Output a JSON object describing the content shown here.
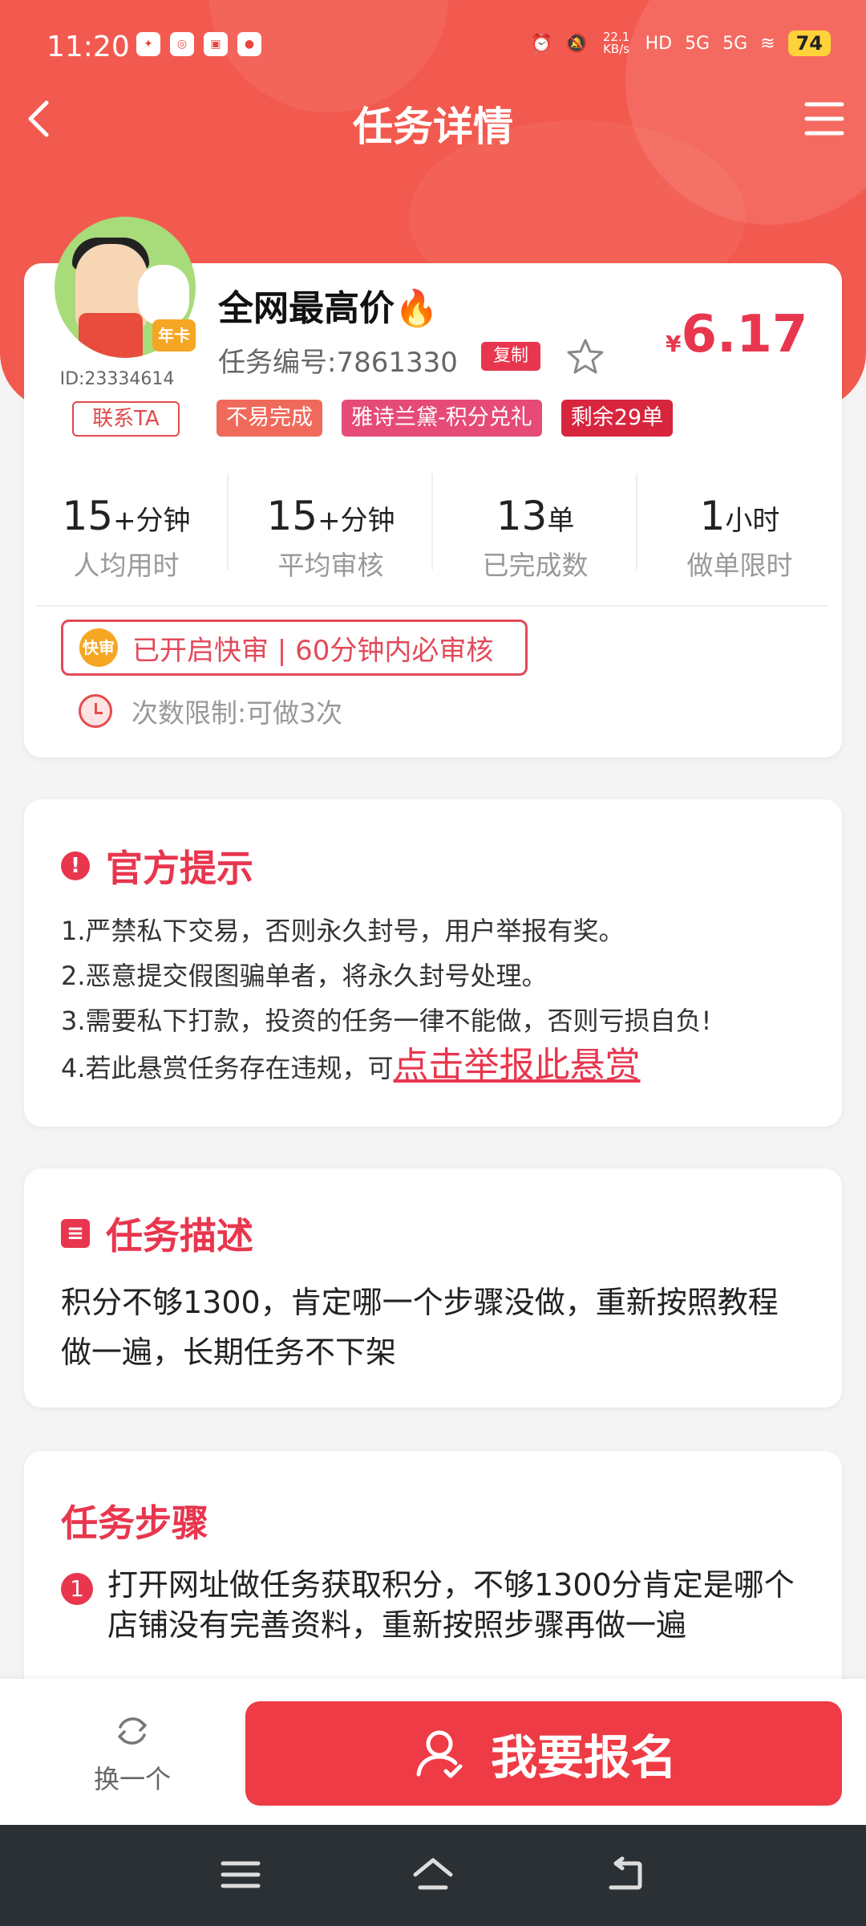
{
  "status_bar": {
    "time": "11:20",
    "net_speed": "22.1",
    "net_unit": "KB/s",
    "hd": "HD",
    "sig1": "5G",
    "sig2": "5G",
    "battery": "74"
  },
  "header": {
    "title": "任务详情"
  },
  "task": {
    "name": "全网最高价🔥",
    "task_id": "任务编号:7861330",
    "copy_label": "复制",
    "price_currency": "¥",
    "price_value": "6.17",
    "user_id": "ID:23334614",
    "badge": "年卡",
    "contact_label": "联系TA",
    "tags": [
      "不易完成",
      "雅诗兰黛-积分兑礼",
      "剩余29单"
    ],
    "stats": [
      {
        "value": "15",
        "unit": "+分钟",
        "label": "人均用时"
      },
      {
        "value": "15",
        "unit": "+分钟",
        "label": "平均审核"
      },
      {
        "value": "13",
        "unit": "单",
        "label": "已完成数"
      },
      {
        "value": "1",
        "unit": "小时",
        "label": "做单限时"
      }
    ],
    "fast_icon": "快审",
    "fast_review": "已开启快审 | 60分钟内必审核",
    "limit": "次数限制:可做3次"
  },
  "notice": {
    "title": "官方提示",
    "lines": [
      "1.严禁私下交易，否则永久封号，用户举报有奖。",
      "2.恶意提交假图骗单者，将永久封号处理。",
      "3.需要私下打款，投资的任务一律不能做，否则亏损自负!",
      "4.若此悬赏任务存在违规，可"
    ],
    "report_link": "点击举报此悬赏"
  },
  "description": {
    "title": "任务描述",
    "text": "积分不够1300，肯定哪一个步骤没做，重新按照教程做一遍，长期任务不下架"
  },
  "steps": {
    "title": "任务步骤",
    "items": [
      {
        "num": "1",
        "text": "打开网址做任务获取积分，不够1300分肯定是哪个店铺没有完善资料，重新按照步骤再做一遍"
      }
    ]
  },
  "bottom_bar": {
    "switch_label": "换一个",
    "signup_label": "我要报名"
  },
  "colors": {
    "primary": "#ee3b45",
    "header_bg": "#f35a4f",
    "accent_text": "#e8364e"
  }
}
